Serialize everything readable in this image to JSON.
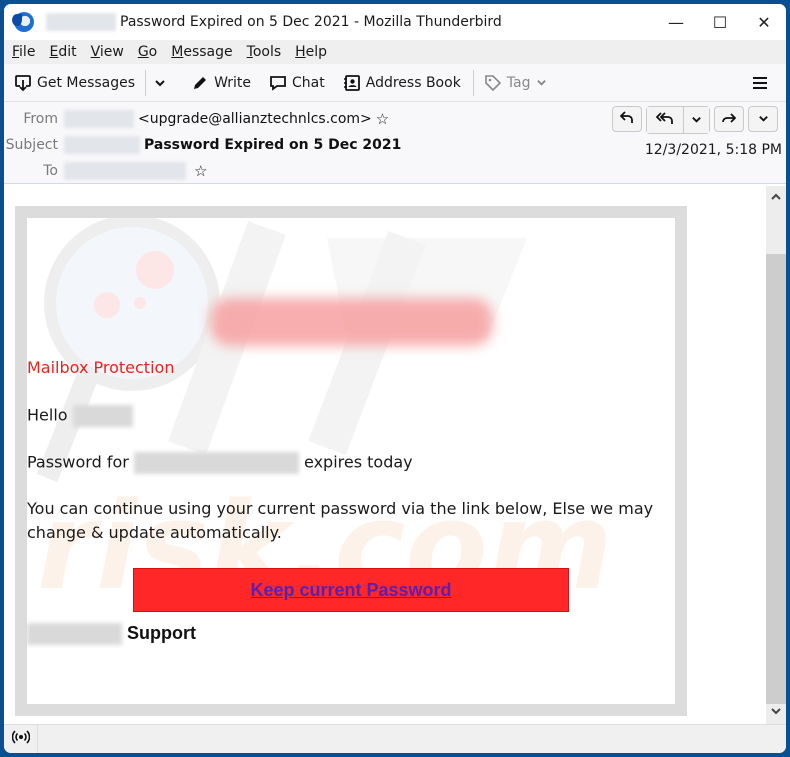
{
  "window": {
    "title": "Password Expired on 5 Dec 2021 - Mozilla Thunderbird",
    "controls": {
      "minimize": "—",
      "maximize": "☐",
      "close": "✕"
    }
  },
  "menu": [
    {
      "label": "File",
      "accel": "F",
      "rest": "ile"
    },
    {
      "label": "Edit",
      "accel": "E",
      "rest": "dit"
    },
    {
      "label": "View",
      "accel": "V",
      "rest": "iew"
    },
    {
      "label": "Go",
      "accel": "G",
      "rest": "o"
    },
    {
      "label": "Message",
      "accel": "M",
      "rest": "essage"
    },
    {
      "label": "Tools",
      "accel": "T",
      "rest": "ools"
    },
    {
      "label": "Help",
      "accel": "H",
      "rest": "elp"
    }
  ],
  "toolbar": {
    "get_messages": "Get Messages",
    "write": "Write",
    "chat": "Chat",
    "address_book": "Address Book",
    "tag": "Tag"
  },
  "header": {
    "from_label": "From",
    "from_email": "<upgrade@allianztechnlcs.com>",
    "subject_label": "Subject",
    "subject": "Password Expired on 5 Dec 2021",
    "to_label": "To",
    "date": "12/3/2021, 5:18 PM"
  },
  "email": {
    "mailbox_title": "Mailbox Protection",
    "greeting": "Hello",
    "password_prefix": "Password for",
    "password_suffix": "expires today",
    "body_line1": "You can continue using  your current  password via the link below, Else we may",
    "body_line2": "change & update automatically.",
    "cta_label": "Keep current  Password",
    "signature": "Support"
  },
  "colors": {
    "accent_red": "#e8231f",
    "cta_background": "#ff2727",
    "cta_link": "#5b1fb2",
    "window_frame": "#0a4f92"
  }
}
